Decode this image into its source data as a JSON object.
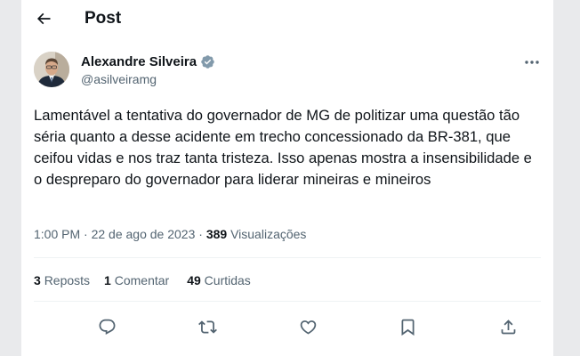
{
  "header": {
    "title": "Post"
  },
  "author": {
    "name": "Alexandre Silveira",
    "handle": "@asilveiramg",
    "verified_icon": "verified-badge-icon"
  },
  "tweet": {
    "text": "Lamentável a tentativa do governador de MG de politizar uma questão tão séria quanto a desse acidente em trecho concessionado da BR-381, que ceifou vidas e nos traz tanta tristeza. Isso apenas mostra a insensibilidade e o despreparo do governador para liderar mineiras e mineiros"
  },
  "meta": {
    "time": "1:00 PM",
    "separator": "·",
    "date": "22 de ago de 2023",
    "views_count": "389",
    "views_label": "Visualizações"
  },
  "stats": {
    "reposts_count": "3",
    "reposts_label": "Reposts",
    "comments_count": "1",
    "comments_label": "Comentar",
    "likes_count": "49",
    "likes_label": "Curtidas"
  },
  "actions": [
    "reply-icon",
    "repost-icon",
    "like-icon",
    "bookmark-icon",
    "share-icon"
  ],
  "colors": {
    "text": "#0f1419",
    "secondary": "#536471",
    "verified": "#829aab",
    "border": "#eff3f4"
  }
}
